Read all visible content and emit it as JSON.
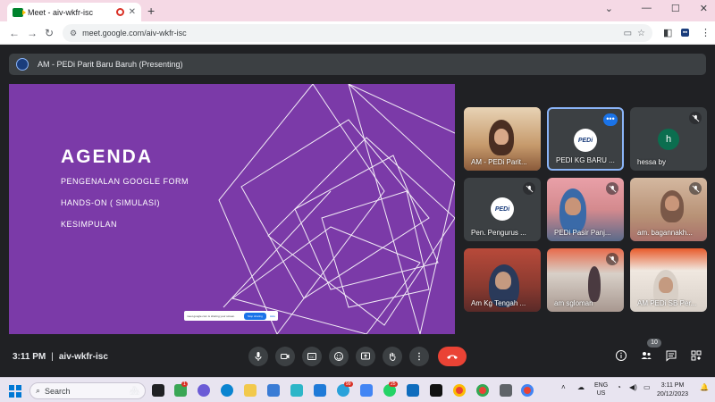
{
  "browser": {
    "tab_title": "Meet - aiv-wkfr-isc",
    "new_tab": "+",
    "url": "meet.google.com/aiv-wkfr-isc",
    "window_min": "—",
    "window_max": "☐",
    "window_close": "✕"
  },
  "meet": {
    "presenting_title": "AM - PEDi Parit Baru Baruh (Presenting)",
    "slide": {
      "title": "AGENDA",
      "items": [
        "PENGENALAN GOOGLE FORM",
        "HANDS-ON ( SIMULASI)",
        "KESIMPULAN"
      ],
      "share_banner": {
        "text": "meet.google.com is sharing your screen.",
        "stop": "Stop sharing",
        "hide": "Hide"
      }
    },
    "tiles": [
      {
        "name": "AM - PEDi Parit...",
        "muted": false
      },
      {
        "name": "PEDI KG BARU ...",
        "muted": false,
        "avatar_text": "PEDi"
      },
      {
        "name": "hessa by",
        "muted": true,
        "avatar_letter": "h"
      },
      {
        "name": "Pen. Pengurus ...",
        "muted": true,
        "avatar_text": "PEDi"
      },
      {
        "name": "PEDi Pasir Panj...",
        "muted": true
      },
      {
        "name": "am. bagannakh...",
        "muted": true
      },
      {
        "name": "Am Kg Tengah ...",
        "muted": false
      },
      {
        "name": "am sgloman",
        "muted": true
      },
      {
        "name": "AM PEDi SB Per...",
        "muted": false
      }
    ],
    "time": "3:11 PM",
    "separator": "|",
    "meeting_code": "aiv-wkfr-isc",
    "participant_count": "10"
  },
  "taskbar": {
    "search_label": "Search",
    "lang_top": "ENG",
    "lang_bottom": "US",
    "clock_time": "3:11 PM",
    "clock_date": "20/12/2023",
    "badge_1": "1",
    "badge_2": "25",
    "badge_3": "99"
  },
  "colors": {
    "slide_bg": "#7b3aa8",
    "meet_bg": "#202124",
    "leave_red": "#ea4335",
    "accent_blue": "#8ab4f8"
  }
}
